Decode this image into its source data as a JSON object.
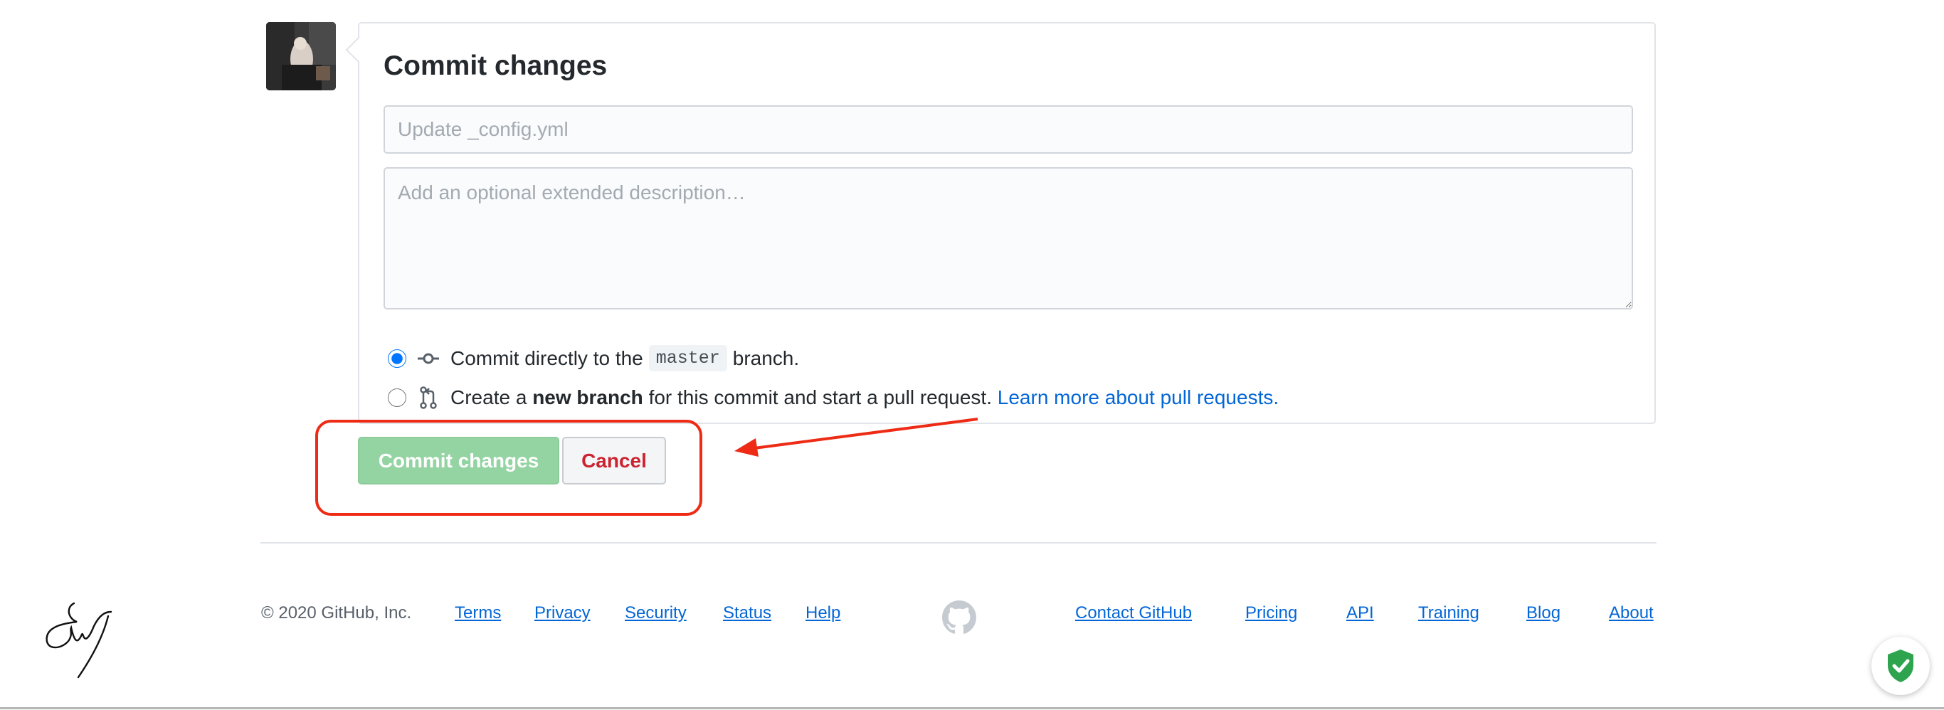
{
  "commit_form": {
    "title": "Commit changes",
    "summary_placeholder": "Update _config.yml",
    "description_placeholder": "Add an optional extended description…",
    "option_direct": {
      "prefix": "Commit directly to the",
      "branch": "master",
      "suffix": "branch.",
      "selected": true
    },
    "option_new_branch": {
      "prefix": "Create a",
      "bold": "new branch",
      "suffix": "for this commit and start a pull request.",
      "link": "Learn more about pull requests.",
      "selected": false
    },
    "commit_button": "Commit changes",
    "cancel_button": "Cancel"
  },
  "footer": {
    "copyright": "© 2020 GitHub, Inc.",
    "left_links": [
      "Terms",
      "Privacy",
      "Security",
      "Status",
      "Help"
    ],
    "right_links": [
      "Contact GitHub",
      "Pricing",
      "API",
      "Training",
      "Blog",
      "About"
    ]
  },
  "colors": {
    "commit_button_bg": "#94d3a2",
    "cancel_text": "#cb2431",
    "link": "#0366d6",
    "annotation": "#ee2b14",
    "shield": "#2ea44f"
  },
  "icons": {
    "commit": "git-commit-icon",
    "pull_request": "git-pull-request-icon",
    "footer_logo": "github-octocat-icon",
    "badge": "shield-check-icon"
  }
}
